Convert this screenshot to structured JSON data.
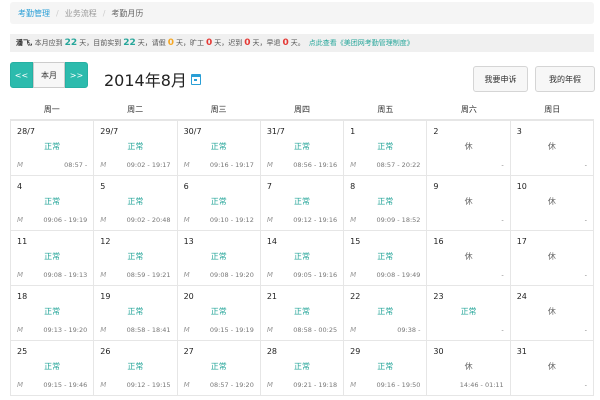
{
  "breadcrumb": [
    "考勤管理",
    "业务流程",
    "考勤月历"
  ],
  "summary": {
    "name": "潘飞,",
    "t1": "本月应到",
    "due": "22",
    "t2": "天，目前实到",
    "actual": "22",
    "t3": "天，请假",
    "leave": "0",
    "t4": "天，旷工",
    "absent": "0",
    "t5": "天，迟到",
    "late": "0",
    "t6": "天，早退",
    "early": "0",
    "t7": "天。",
    "link": "点此查看《美团网考勤管理制度》"
  },
  "nav": {
    "prev": "<<",
    "today": "本月",
    "next": ">>"
  },
  "month_title": "2014年8月",
  "actions": {
    "appeal": "我要申诉",
    "leave": "我的年假"
  },
  "weekdays": [
    "周一",
    "周二",
    "周三",
    "周四",
    "周五",
    "周六",
    "周日"
  ],
  "days": [
    {
      "date": "28/7",
      "status": "正常",
      "type": "normal",
      "mark": "M",
      "time": "08:57 -"
    },
    {
      "date": "29/7",
      "status": "正常",
      "type": "normal",
      "mark": "M",
      "time": "09:02 - 19:17"
    },
    {
      "date": "30/7",
      "status": "正常",
      "type": "normal",
      "mark": "M",
      "time": "09:16 - 19:17"
    },
    {
      "date": "31/7",
      "status": "正常",
      "type": "normal",
      "mark": "M",
      "time": "08:56 - 19:16"
    },
    {
      "date": "1",
      "status": "正常",
      "type": "normal",
      "mark": "M",
      "time": "08:57 - 20:22"
    },
    {
      "date": "2",
      "status": "休",
      "type": "rest",
      "mark": "",
      "time": "-"
    },
    {
      "date": "3",
      "status": "休",
      "type": "rest",
      "mark": "",
      "time": "-"
    },
    {
      "date": "4",
      "status": "正常",
      "type": "normal",
      "mark": "M",
      "time": "09:06 - 19:19"
    },
    {
      "date": "5",
      "status": "正常",
      "type": "normal",
      "mark": "M",
      "time": "09:02 - 20:48"
    },
    {
      "date": "6",
      "status": "正常",
      "type": "normal",
      "mark": "M",
      "time": "09:10 - 19:12"
    },
    {
      "date": "7",
      "status": "正常",
      "type": "normal",
      "mark": "M",
      "time": "09:12 - 19:16"
    },
    {
      "date": "8",
      "status": "正常",
      "type": "normal",
      "mark": "M",
      "time": "09:09 - 18:52"
    },
    {
      "date": "9",
      "status": "休",
      "type": "rest",
      "mark": "",
      "time": "-"
    },
    {
      "date": "10",
      "status": "休",
      "type": "rest",
      "mark": "",
      "time": "-"
    },
    {
      "date": "11",
      "status": "正常",
      "type": "normal",
      "mark": "M",
      "time": "09:08 - 19:13"
    },
    {
      "date": "12",
      "status": "正常",
      "type": "normal",
      "mark": "M",
      "time": "08:59 - 19:21"
    },
    {
      "date": "13",
      "status": "正常",
      "type": "normal",
      "mark": "M",
      "time": "09:08 - 19:20"
    },
    {
      "date": "14",
      "status": "正常",
      "type": "normal",
      "mark": "M",
      "time": "09:05 - 19:16"
    },
    {
      "date": "15",
      "status": "正常",
      "type": "normal",
      "mark": "M",
      "time": "09:08 - 19:49"
    },
    {
      "date": "16",
      "status": "休",
      "type": "rest",
      "mark": "",
      "time": "-"
    },
    {
      "date": "17",
      "status": "休",
      "type": "rest",
      "mark": "",
      "time": "-"
    },
    {
      "date": "18",
      "status": "正常",
      "type": "normal",
      "mark": "M",
      "time": "09:13 - 19:20"
    },
    {
      "date": "19",
      "status": "正常",
      "type": "normal",
      "mark": "M",
      "time": "08:58 - 18:41"
    },
    {
      "date": "20",
      "status": "正常",
      "type": "normal",
      "mark": "M",
      "time": "09:15 - 19:19"
    },
    {
      "date": "21",
      "status": "正常",
      "type": "normal",
      "mark": "M",
      "time": "08:58 - 00:25"
    },
    {
      "date": "22",
      "status": "正常",
      "type": "normal",
      "mark": "M",
      "time": "09:38 -"
    },
    {
      "date": "23",
      "status": "正常",
      "type": "normal",
      "mark": "",
      "time": "-"
    },
    {
      "date": "24",
      "status": "休",
      "type": "rest",
      "mark": "",
      "time": "-"
    },
    {
      "date": "25",
      "status": "正常",
      "type": "normal",
      "mark": "M",
      "time": "09:15 - 19:46"
    },
    {
      "date": "26",
      "status": "正常",
      "type": "normal",
      "mark": "M",
      "time": "09:12 - 19:15"
    },
    {
      "date": "27",
      "status": "正常",
      "type": "normal",
      "mark": "M",
      "time": "08:57 - 19:20"
    },
    {
      "date": "28",
      "status": "正常",
      "type": "normal",
      "mark": "M",
      "time": "09:21 - 19:18"
    },
    {
      "date": "29",
      "status": "正常",
      "type": "normal",
      "mark": "M",
      "time": "09:16 - 19:50"
    },
    {
      "date": "30",
      "status": "休",
      "type": "rest",
      "mark": "",
      "time": "14:46 - 01:11"
    },
    {
      "date": "31",
      "status": "休",
      "type": "rest",
      "mark": "",
      "time": "-"
    }
  ]
}
